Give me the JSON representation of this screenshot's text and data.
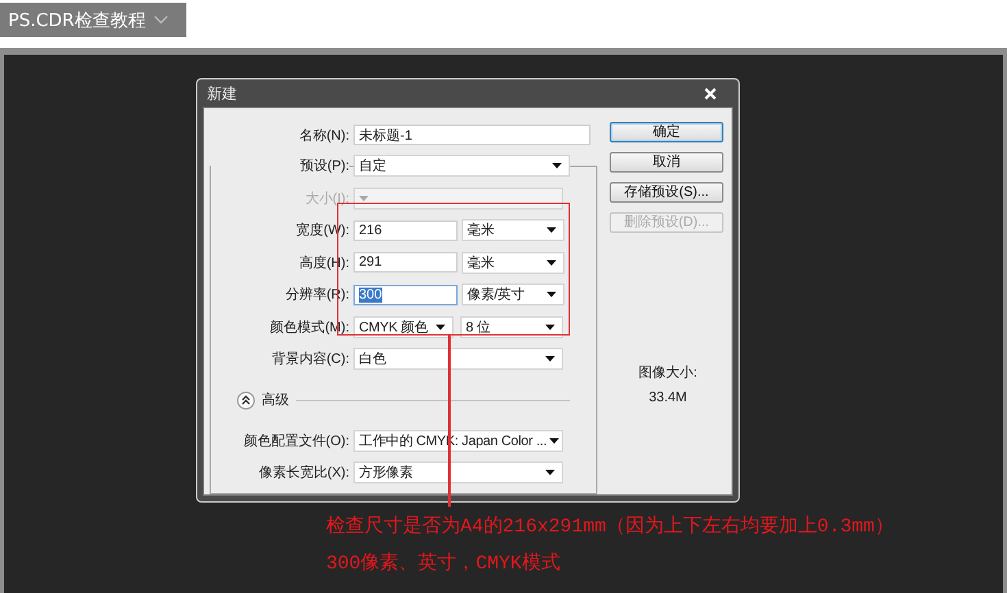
{
  "header": {
    "title": "PS.CDR检查教程"
  },
  "dialog": {
    "title": "新建",
    "name_field": {
      "label": "名称(N):",
      "value": "未标题-1"
    },
    "fields": [
      {
        "kind": "select",
        "label": "预设(P):",
        "value": "自定",
        "disabled": false
      },
      {
        "kind": "select",
        "label": "大小(I):",
        "disabled": true
      },
      {
        "kind": "measure",
        "label": "宽度(W):",
        "value": "216",
        "unit": "毫米",
        "highlighted": false
      },
      {
        "kind": "measure",
        "label": "高度(H):",
        "value": "291",
        "unit": "毫米",
        "highlighted": false
      },
      {
        "kind": "measure",
        "label": "分辨率(R):",
        "value": "300",
        "unit": "像素/英寸",
        "highlighted": true
      },
      {
        "kind": "dual",
        "label": "颜色模式(M):",
        "value": "CMYK 颜色",
        "unit": "8 位"
      },
      {
        "kind": "select",
        "label": "背景内容(C):",
        "value": "白色",
        "disabled": false
      }
    ],
    "advanced": {
      "label": "高级",
      "expanded": true
    },
    "advanced_fields": [
      {
        "kind": "select",
        "label": "颜色配置文件(O):",
        "value": "工作中的 CMYK: Japan Color ...",
        "disabled": false
      },
      {
        "kind": "select",
        "label": "像素长宽比(X):",
        "value": "方形像素",
        "disabled": false
      }
    ],
    "buttons": [
      {
        "label": "确定",
        "default": true,
        "disabled": false
      },
      {
        "label": "取消",
        "default": false,
        "disabled": false
      },
      {
        "label": "存储预设(S)...",
        "default": false,
        "disabled": false
      },
      {
        "label": "删除预设(D)...",
        "default": false,
        "disabled": true
      }
    ],
    "image_size": {
      "label": "图像大小:",
      "value": "33.4M"
    }
  },
  "annotation": {
    "lines": [
      "检查尺寸是否为A4的216x291mm（因为上下左右均要加上0.3mm）",
      "300像素、英寸，CMYK模式"
    ]
  }
}
